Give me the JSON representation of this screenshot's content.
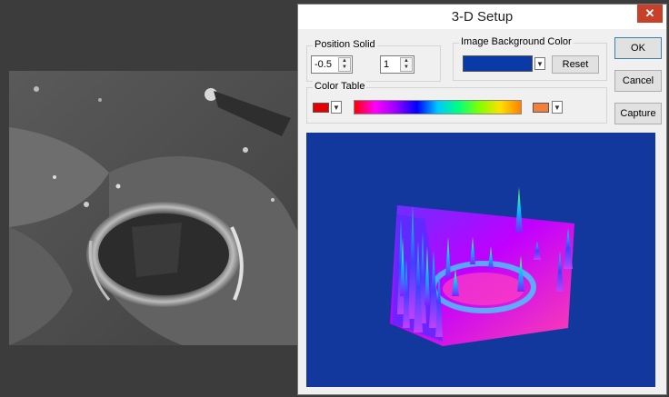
{
  "window": {
    "title": "3-D Setup",
    "close_label": "✕"
  },
  "position_solid": {
    "label": "Position Solid",
    "value1": "-0.5",
    "value2": "1"
  },
  "background_color": {
    "label": "Image Background Color",
    "color": "#0a3aa8",
    "reset_label": "Reset"
  },
  "color_table": {
    "label": "Color Table",
    "low_color": "#e60000",
    "high_color": "#f0803c"
  },
  "buttons": {
    "ok": "OK",
    "cancel": "Cancel",
    "capture": "Capture"
  },
  "icons": {
    "spin": "spin-arrows-icon",
    "dropdown": "chevron-down-icon",
    "close": "close-icon"
  }
}
